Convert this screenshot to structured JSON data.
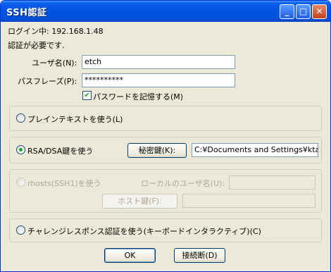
{
  "window": {
    "title": "SSH認証"
  },
  "titlebar_buttons": {
    "minimize": "_",
    "maximize": "□",
    "close": "✕"
  },
  "login_status": "ログイン中: 192.168.1.48",
  "auth_required": "認証が必要です.",
  "username": {
    "label": "ユーザ名(N):",
    "value": "etch"
  },
  "passphrase": {
    "label": "パスフレーズ(P):",
    "value": "**********"
  },
  "remember_password": {
    "label": "パスワードを記憶する(M)",
    "checked": true
  },
  "options": {
    "plaintext": {
      "label": "プレインテキストを使う(L)",
      "selected": false
    },
    "rsa": {
      "label": "RSA/DSA鍵を使う",
      "selected": true,
      "private_key_button": "秘密鍵(K):",
      "key_path": "C:¥Documents and Settings¥ktana"
    },
    "rhosts": {
      "label": "rhosts(SSH1)を使う",
      "selected": false,
      "disabled": true,
      "local_user_label": "ローカルのユーザ名(U):",
      "local_user_value": "",
      "host_key_button": "ホスト鍵(F):",
      "host_key_value": ""
    },
    "challenge": {
      "label": "チャレンジレスポンス認証を使う(キーボードインタラクティブ)(C)",
      "selected": false
    }
  },
  "buttons": {
    "ok": "OK",
    "disconnect": "接続断(D)"
  },
  "colors": {
    "titlebar": "#0054e3",
    "window_bg": "#ece9d8",
    "radio_dot": "#21a121"
  }
}
